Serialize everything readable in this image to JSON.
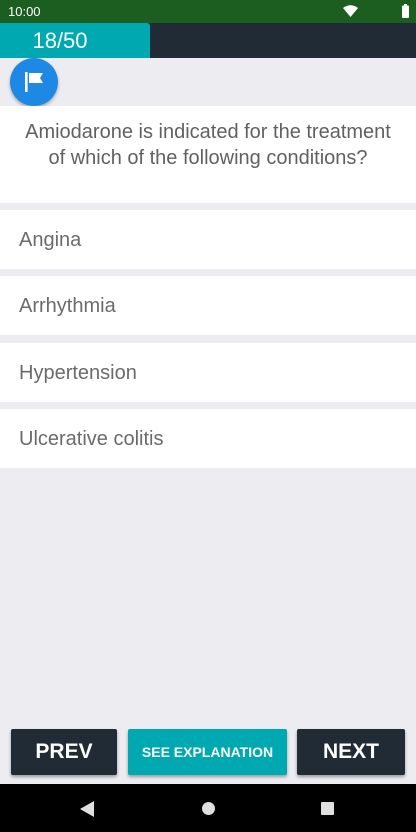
{
  "status_bar": {
    "time": "10:00",
    "icons": [
      "wifi-icon",
      "battery-icon"
    ]
  },
  "quiz": {
    "counter": "18/50",
    "progress_fraction": 0.36,
    "flag_icon": "flag-icon"
  },
  "question": {
    "text": "Amiodarone is indicated for the treatment of which of the following conditions?"
  },
  "answers": [
    {
      "label": "Angina"
    },
    {
      "label": "Arrhythmia"
    },
    {
      "label": "Hypertension"
    },
    {
      "label": "Ulcerative colitis"
    }
  ],
  "buttons": {
    "prev": "PREV",
    "explanation": "SEE EXPLANATION",
    "next": "NEXT"
  },
  "nav_bar": {
    "icons": [
      "back-icon",
      "home-icon",
      "recents-icon"
    ]
  },
  "colors": {
    "status_bar": "#1B5E20",
    "header": "#212B36",
    "accent": "#00A9B2",
    "flag": "#1E88E5",
    "background": "#ECECF1"
  }
}
